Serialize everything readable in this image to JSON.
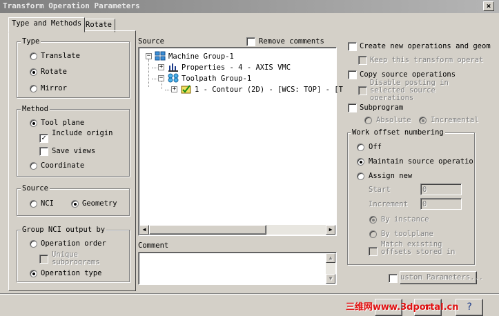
{
  "window": {
    "title": "Transform Operation Parameters",
    "close_glyph": "×"
  },
  "tabs": [
    {
      "label": "Type and Methods"
    },
    {
      "label": "Rotate"
    }
  ],
  "type_group": {
    "legend": "Type",
    "options": [
      "Translate",
      "Rotate",
      "Mirror"
    ],
    "selected": "Rotate"
  },
  "method_group": {
    "legend": "Method",
    "tool_plane": "Tool plane",
    "include_origin": "Include origin",
    "save_views": "Save views",
    "coordinate": "Coordinate"
  },
  "source_group": {
    "legend": "Source",
    "nci": "NCI",
    "geometry": "Geometry"
  },
  "group_nci": {
    "legend": "Group NCI output by",
    "operation_order": "Operation order",
    "unique_subprograms": "Unique subprograms",
    "operation_type": "Operation type"
  },
  "source_panel": {
    "label": "Source",
    "remove_comments": "Remove comments",
    "tree": [
      {
        "label": "Machine Group-1",
        "icon": "machine-group-icon"
      },
      {
        "label": "Properties - 4 - AXIS VMC",
        "icon": "properties-icon"
      },
      {
        "label": "Toolpath Group-1",
        "icon": "toolpath-group-icon"
      },
      {
        "label": "1 - Contour (2D) - [WCS: TOP] - [T",
        "icon": "contour-operation-icon"
      }
    ]
  },
  "comment": {
    "label": "Comment",
    "value": ""
  },
  "right_options": {
    "create_new": "Create new operations and geom",
    "keep_transform": "Keep this transform operat",
    "copy_source": "Copy source operations",
    "disable_posting": "Disable posting in selected source operations",
    "subprogram": "Subprogram",
    "absolute": "Absolute",
    "incremental": "Incremental"
  },
  "work_offset": {
    "legend": "Work offset numbering",
    "off": "Off",
    "maintain": "Maintain source operatio",
    "assign_new": "Assign new",
    "start_label": "Start",
    "start_value": "0",
    "increment_label": "Increment",
    "increment_value": "0",
    "by_instance": "By instance",
    "by_toolplane": "By toolplane",
    "match_existing": "Match existing offsets stored in"
  },
  "custom_params_button": "ustom Parameters...",
  "watermark": "三维网www.3dportal.cn"
}
